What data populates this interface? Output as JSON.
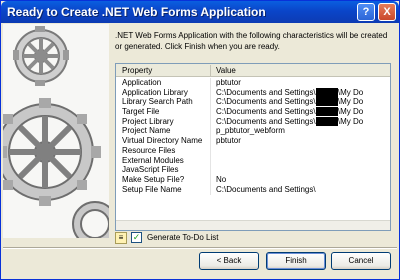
{
  "window": {
    "title": "Ready to Create .NET Web Forms Application",
    "help_glyph": "?",
    "close_glyph": "X"
  },
  "description": ".NET Web Forms Application with the following characteristics will be created or generated.  Click Finish when you are ready.",
  "grid": {
    "columns": {
      "property": "Property",
      "value": "Value"
    },
    "rows": [
      {
        "property": "Application",
        "value": "pbtutor",
        "redacted": false
      },
      {
        "property": "Application Library",
        "value_prefix": "C:\\Documents and Settings\\",
        "redacted": true,
        "value_suffix": "\\My Do"
      },
      {
        "property": "Library Search Path",
        "value_prefix": "C:\\Documents and Settings\\",
        "redacted": true,
        "value_suffix": "\\My Do"
      },
      {
        "property": "Target File",
        "value_prefix": "C:\\Documents and Settings\\",
        "redacted": true,
        "value_suffix": "\\My Do"
      },
      {
        "property": "Project Library",
        "value_prefix": "C:\\Documents and Settings\\",
        "redacted": true,
        "value_suffix": "\\My Do"
      },
      {
        "property": "Project Name",
        "value": "p_pbtutor_webform",
        "redacted": false
      },
      {
        "property": "Virtual Directory Name",
        "value": "pbtutor",
        "redacted": false
      },
      {
        "property": "Resource Files",
        "value": "",
        "redacted": false
      },
      {
        "property": "External Modules",
        "value": "",
        "redacted": false
      },
      {
        "property": "JavaScript Files",
        "value": "",
        "redacted": false
      },
      {
        "property": "Make Setup File?",
        "value": "No",
        "redacted": false
      },
      {
        "property": "Setup File Name",
        "value": "C:\\Documents and Settings\\",
        "redacted": false
      }
    ]
  },
  "checkbox": {
    "label": "Generate To-Do List",
    "checked": true,
    "check_glyph": "✓"
  },
  "buttons": {
    "back": "< Back",
    "finish": "Finish",
    "cancel": "Cancel"
  },
  "colors": {
    "titlebar": "#0a45c9",
    "dialog_bg": "#ece9d8",
    "close_button": "#c9482a"
  },
  "icons": [
    "gear-illustration",
    "todo-list-icon"
  ]
}
